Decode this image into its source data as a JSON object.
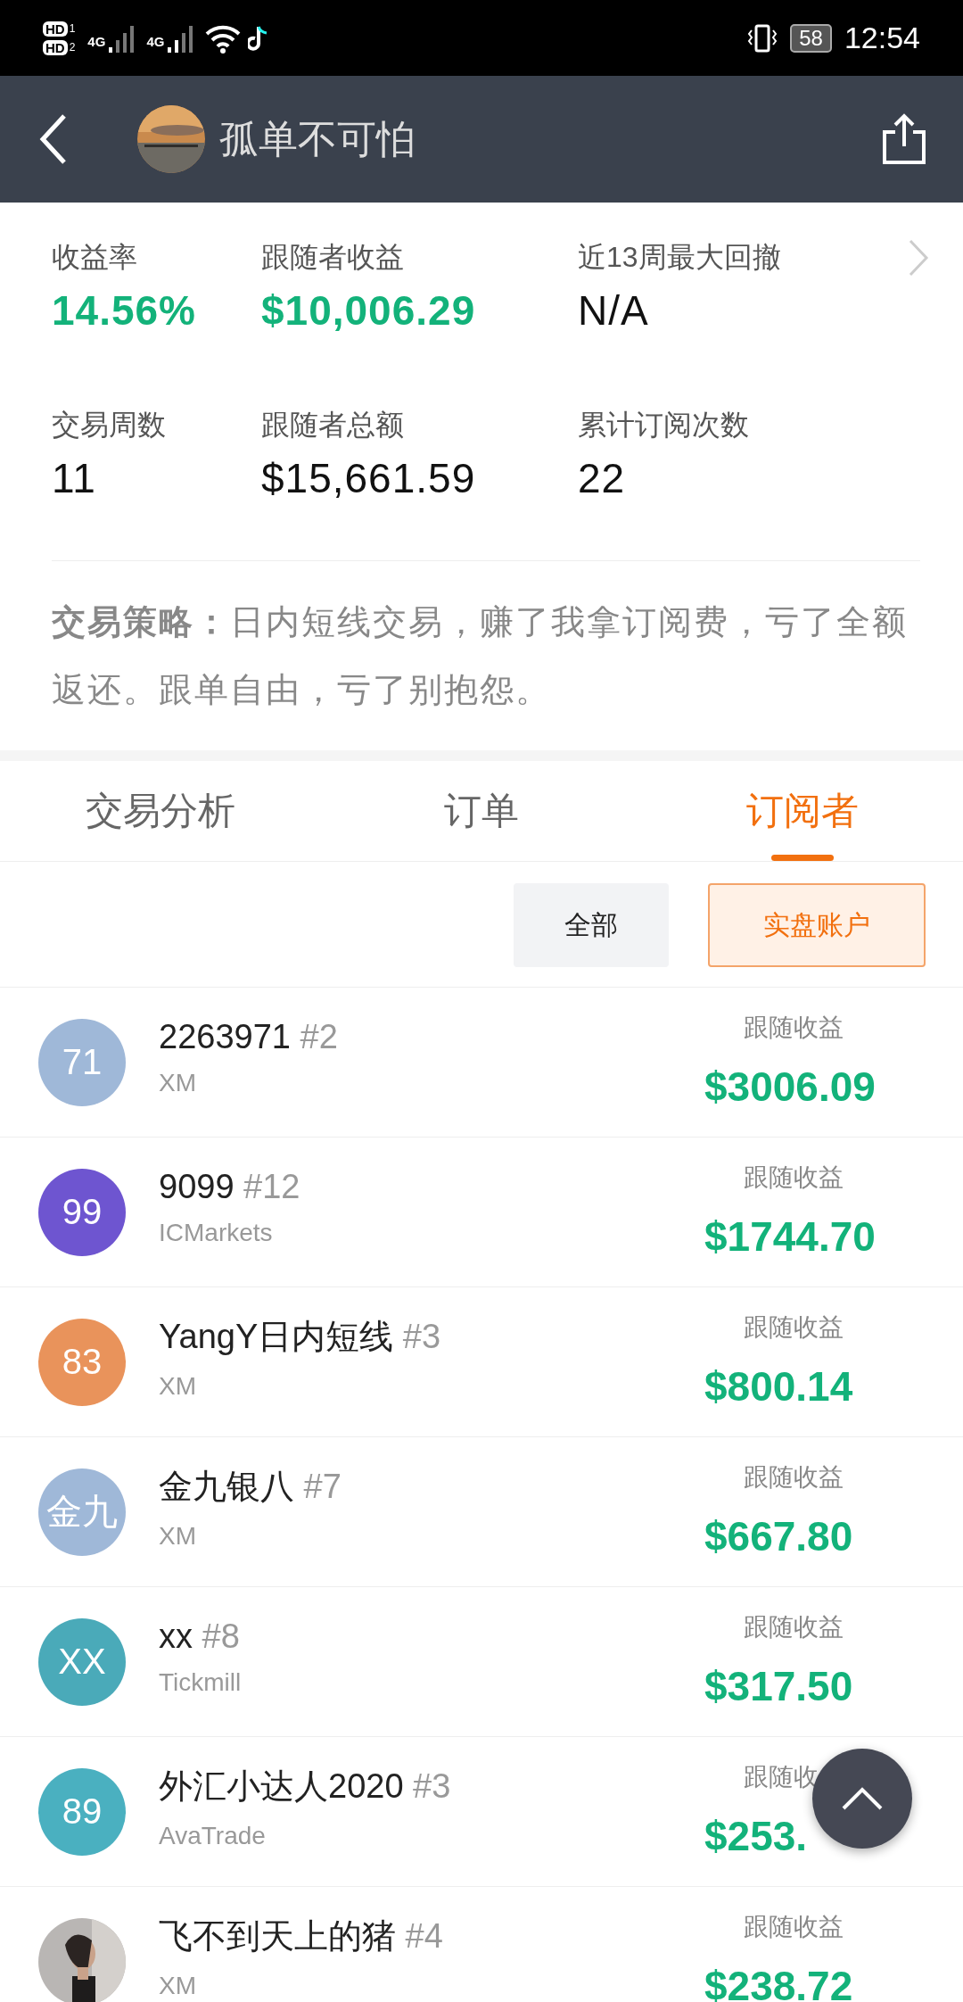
{
  "status_bar": {
    "sims": [
      {
        "label": "HD",
        "index": "1"
      },
      {
        "label": "HD",
        "index": "2"
      }
    ],
    "networks": [
      "4G",
      "4G"
    ],
    "battery": "58",
    "time": "12:54"
  },
  "header": {
    "title": "孤单不可怕"
  },
  "stats": [
    {
      "label": "收益率",
      "value": "14.56%",
      "kind": "positive"
    },
    {
      "label": "跟随者收益",
      "value": "$10,006.29",
      "kind": "positive"
    },
    {
      "label": "近13周最大回撤",
      "value": "N/A",
      "kind": "plain"
    },
    {
      "label": "交易周数",
      "value": "11",
      "kind": "plain"
    },
    {
      "label": "跟随者总额",
      "value": "$15,661.59",
      "kind": "plain"
    },
    {
      "label": "累计订阅次数",
      "value": "22",
      "kind": "plain"
    }
  ],
  "strategy": "**交易策略：**日内短线交易，赚了我拿订阅费，亏了全额返还。跟单自由，亏了别抱怨。",
  "tabs": [
    {
      "label": "交易分析",
      "selected": false
    },
    {
      "label": "订单",
      "selected": false
    },
    {
      "label": "订阅者",
      "selected": true
    }
  ],
  "filters": [
    {
      "label": "全部",
      "selected": false
    },
    {
      "label": "实盘账户",
      "selected": true
    }
  ],
  "subscribers": [
    {
      "avatar": "71",
      "kind": "initials",
      "color": "#9fb8d8",
      "name": "2263971",
      "rank": "#2",
      "broker": "XM",
      "label": "跟随收益",
      "amount": "$3006.09"
    },
    {
      "avatar": "99",
      "kind": "initials",
      "color": "#6e55d0",
      "name": "9099",
      "rank": "#12",
      "broker": "ICMarkets",
      "label": "跟随收益",
      "amount": "$1744.70"
    },
    {
      "avatar": "83",
      "kind": "initials",
      "color": "#e9935b",
      "name": "YangY日内短线",
      "rank": "#3",
      "broker": "XM",
      "label": "跟随收益",
      "amount": "$800.14"
    },
    {
      "avatar": "金九",
      "kind": "initials",
      "color": "#9fb8d8",
      "name": "金九银八",
      "rank": "#7",
      "broker": "XM",
      "label": "跟随收益",
      "amount": "$667.80"
    },
    {
      "avatar": "XX",
      "kind": "initials",
      "color": "#4aaab9",
      "name": "xx ",
      "rank": "#8",
      "broker": "Tickmill",
      "label": "跟随收益",
      "amount": "$317.50"
    },
    {
      "avatar": "89",
      "kind": "initials",
      "color": "#4ab0c0",
      "name": "外汇小达人2020",
      "rank": "#3",
      "broker": "AvaTrade",
      "label": "跟随收",
      "amount": "$253."
    },
    {
      "kind": "picture",
      "name": "飞不到天上的猪",
      "rank": "#4",
      "broker": "XM",
      "label": "跟随收益",
      "amount": "$238.72"
    }
  ]
}
